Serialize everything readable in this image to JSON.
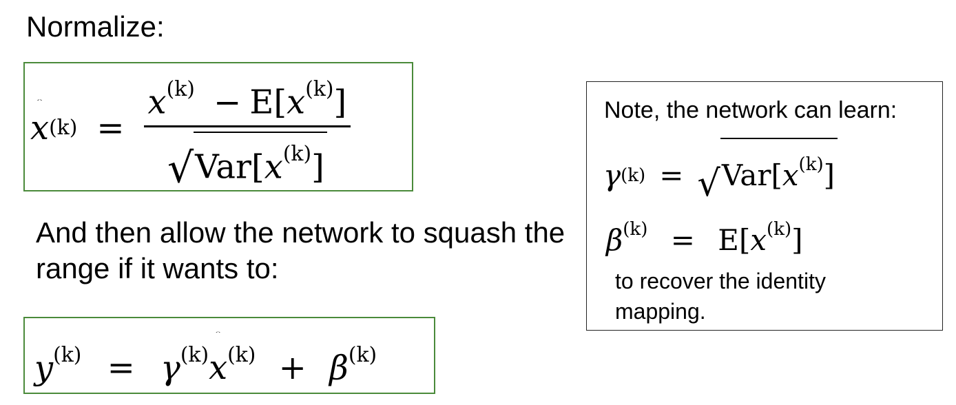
{
  "heading": "Normalize:",
  "paragraph": "And then allow the network to squash the range if it wants to:",
  "note": {
    "title": "Note, the network can learn:",
    "footer": "to recover the identity mapping."
  },
  "math": {
    "x": "x",
    "y": "y",
    "gamma": "γ",
    "beta": "β",
    "sup": "(k)",
    "E": "E",
    "Var": "Var",
    "eq": "=",
    "minus": "−",
    "plus": "+",
    "lbrack": "[",
    "rbrack": "]",
    "sqrt": "√"
  }
}
